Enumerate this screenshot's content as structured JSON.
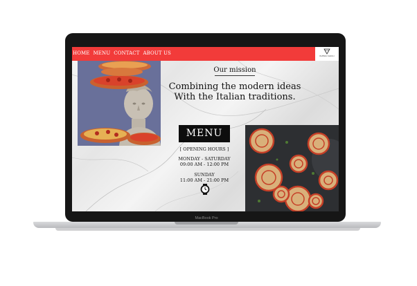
{
  "nav": {
    "items": [
      "HOME",
      "MENU",
      "CONTACT",
      "ABOUT US"
    ]
  },
  "logo": {
    "text": "BARRAS NAPOLI"
  },
  "mission": {
    "title": "Our mission",
    "line1": "Combining the modern ideas",
    "line2": "With the Italian traditions."
  },
  "menu_button": "MENU",
  "hours": {
    "heading": "[ OPENING HOURS ]",
    "weekday_days": "MONDAY - SATURDAY",
    "weekday_time": "09:00 AM - 12:00 PM",
    "sunday_day": "SUNDAY",
    "sunday_time": "11:00 AM - 21:00 PM"
  },
  "laptop": {
    "brand": "MacBook Pro"
  },
  "colors": {
    "nav_bg": "#f23b3a",
    "statue_bg": "#69709a",
    "photo_bg": "#2d2f32",
    "button_bg": "#0d0d0d"
  },
  "icons": {
    "clock": "clock-icon",
    "logo": "triangle-logo-icon"
  }
}
